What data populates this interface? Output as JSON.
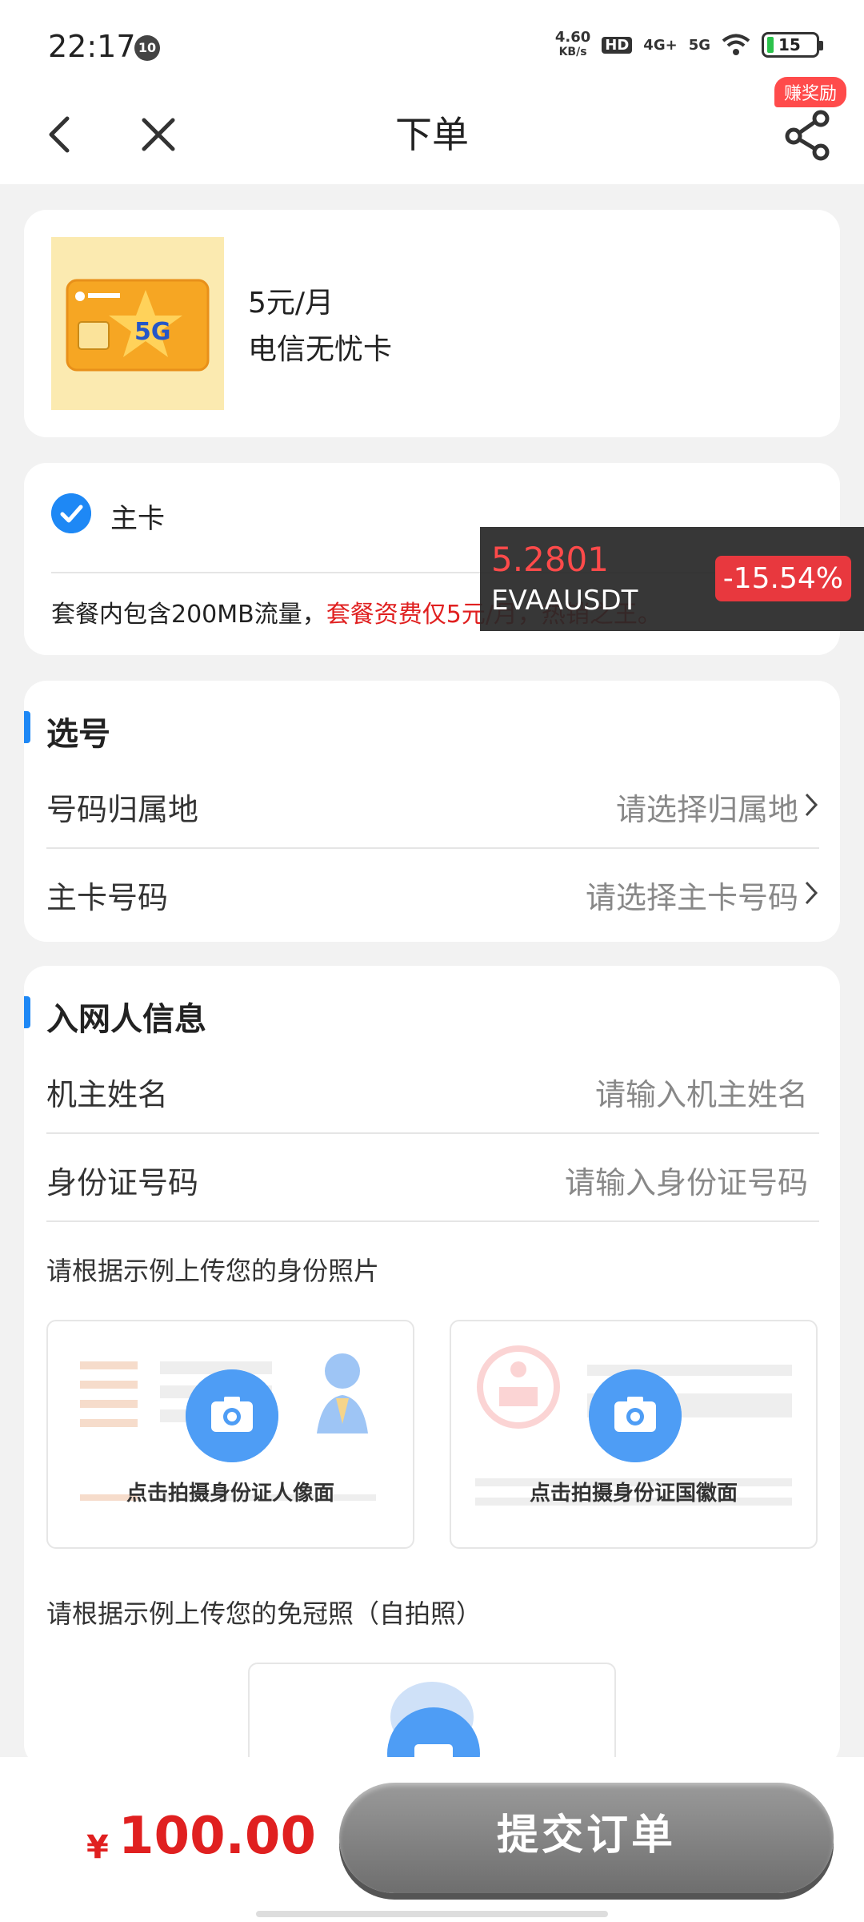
{
  "status_bar": {
    "time": "22:17",
    "notif_badge": "10",
    "net_speed": "4.60",
    "net_speed_unit": "KB/s",
    "hd": "HD",
    "signal1": "4G+",
    "signal2": "5G",
    "battery": "15"
  },
  "nav": {
    "title": "下单",
    "reward_badge": "赚奖励"
  },
  "product": {
    "price_line": "5元/月",
    "name": "电信无忧卡"
  },
  "main_card": {
    "label": "主卡",
    "desc_plain": "套餐内包含200MB流量，",
    "desc_red": "套餐资费仅5元/月，热销之王。"
  },
  "number_section": {
    "title": "选号",
    "rows": [
      {
        "label": "号码归属地",
        "value": "请选择归属地"
      },
      {
        "label": "主卡号码",
        "value": "请选择主卡号码"
      }
    ]
  },
  "info_section": {
    "title": "入网人信息",
    "name_label": "机主姓名",
    "name_placeholder": "请输入机主姓名",
    "id_label": "身份证号码",
    "id_placeholder": "请输入身份证号码",
    "id_photo_hint": "请根据示例上传您的身份照片",
    "front_caption": "点击拍摄身份证人像面",
    "back_caption": "点击拍摄身份证国徽面",
    "selfie_hint": "请根据示例上传您的免冠照（自拍照）"
  },
  "ticker": {
    "price": "5.2801",
    "symbol": "EVAAUSDT",
    "change": "-15.54%"
  },
  "footer": {
    "currency": "¥",
    "amount": "100.00",
    "submit_label": "提交订单"
  },
  "colors": {
    "accent": "#1e88f5",
    "price_red": "#e02020",
    "camera_blue": "#4e9df5"
  }
}
